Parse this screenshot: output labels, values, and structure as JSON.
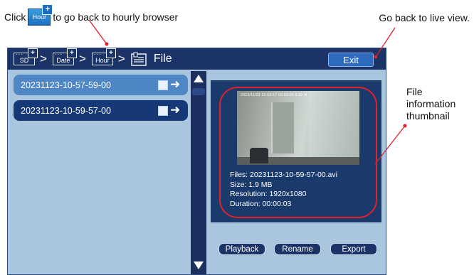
{
  "annotations": {
    "click_prefix": "Click",
    "click_chip_label": "Hour",
    "click_suffix": "to go back to hourly browser",
    "live_view": "Go back to live view.",
    "file_info": "File information thumbnail"
  },
  "breadcrumb": {
    "items": [
      {
        "label": "SD"
      },
      {
        "label": "Date"
      },
      {
        "label": "Hour"
      }
    ],
    "separator": ">",
    "title": "File"
  },
  "exit_button": "Exit",
  "files": [
    {
      "name": "20231123-10-57-59-00",
      "selected": true
    },
    {
      "name": "20231123-10-59-57-00",
      "selected": false
    }
  ],
  "thumbnail": {
    "timestamp": "2023/11/23 10:59:57 00:00:00 0.33 M"
  },
  "file_info": {
    "files": "Files: 20231123-10-59-57-00.avi",
    "size": "Size: 1.9 MB",
    "resolution": "Resolution: 1920x1080",
    "duration": "Duration: 00:00:03"
  },
  "buttons": {
    "playback": "Playback",
    "rename": "Rename",
    "export": "Export"
  },
  "colors": {
    "header_bg": "#1b3366",
    "panel_bg": "#aac6df",
    "highlight_ring": "#e0202a",
    "selected_row": "#4f86c6"
  }
}
